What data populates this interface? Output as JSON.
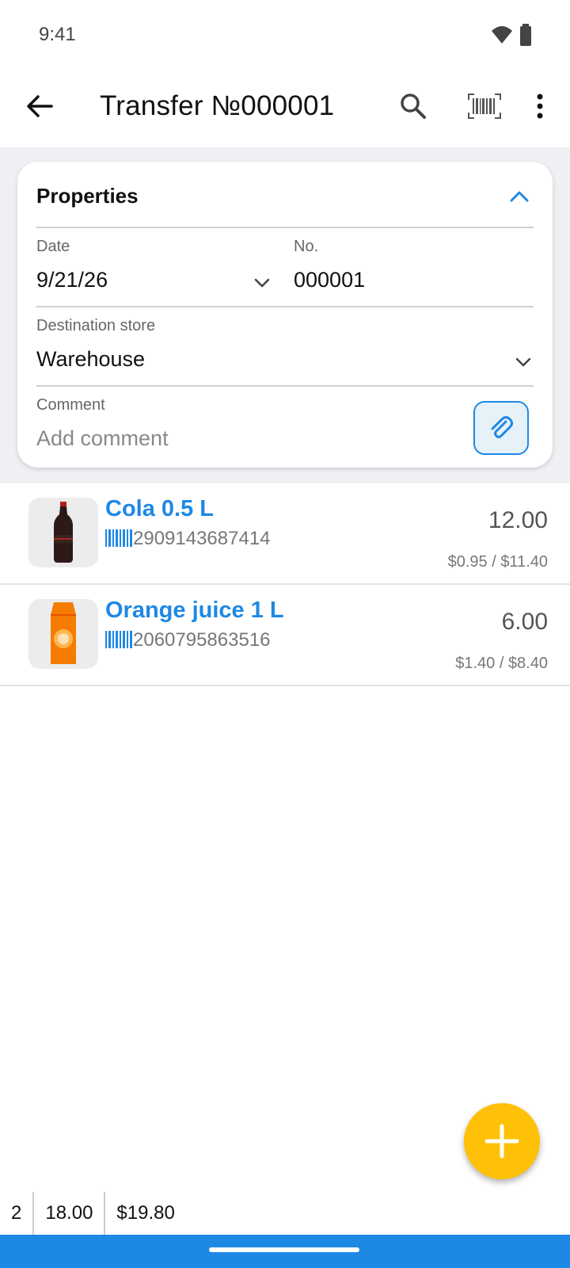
{
  "status_bar": {
    "time": "9:41"
  },
  "app_bar": {
    "title": "Transfer №000001"
  },
  "properties": {
    "title": "Properties",
    "date": {
      "label": "Date",
      "value": "9/21/26"
    },
    "number": {
      "label": "No.",
      "value": "000001"
    },
    "destination": {
      "label": "Destination store",
      "value": "Warehouse"
    },
    "comment": {
      "label": "Comment",
      "placeholder": "Add comment"
    }
  },
  "items": [
    {
      "name": "Cola 0.5 L",
      "barcode": "2909143687414",
      "quantity": "12.00",
      "price": "$0.95",
      "sum": "$11.40",
      "image": "cola-bottle"
    },
    {
      "name": "Orange juice 1 L",
      "barcode": "2060795863516",
      "quantity": "6.00",
      "price": "$1.40",
      "sum": "$8.40",
      "image": "orange-juice-carton"
    }
  ],
  "footer": {
    "count": "2",
    "total_quantity": "18.00",
    "total_sum": "$19.80"
  },
  "colors": {
    "accent": "#1e88e5",
    "fab": "#ffc107",
    "background": "#eef0f3"
  }
}
